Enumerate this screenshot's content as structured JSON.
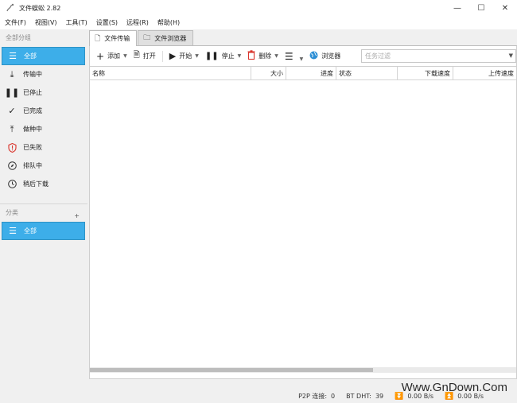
{
  "window": {
    "title": "文件蜈蚣 2.82"
  },
  "menu": [
    "文件(F)",
    "视图(V)",
    "工具(T)",
    "设置(S)",
    "远程(R)",
    "帮助(H)"
  ],
  "sidebar": {
    "group_header": "全部分组",
    "items": [
      {
        "label": "全部",
        "icon": "list-icon"
      },
      {
        "label": "传输中",
        "icon": "download-icon"
      },
      {
        "label": "已停止",
        "icon": "pause-icon"
      },
      {
        "label": "已完成",
        "icon": "check-icon"
      },
      {
        "label": "做种中",
        "icon": "upload-icon"
      },
      {
        "label": "已失败",
        "icon": "shield-alert-icon"
      },
      {
        "label": "排队中",
        "icon": "compass-icon"
      },
      {
        "label": "稍后下载",
        "icon": "clock-icon"
      }
    ],
    "category_header": "分类",
    "category_add": "+",
    "categories": [
      {
        "label": "全部",
        "icon": "list-icon"
      }
    ]
  },
  "tabs": [
    {
      "label": "文件传输",
      "icon": "file-icon"
    },
    {
      "label": "文件浏览器",
      "icon": "folder-icon"
    }
  ],
  "toolbar": {
    "add": "添加",
    "open": "打开",
    "start": "开始",
    "stop": "停止",
    "delete": "删除",
    "browser": "浏览器",
    "filter_placeholder": "任务过滤"
  },
  "table": {
    "columns": [
      "名称",
      "大小",
      "进度",
      "状态",
      "下载速度",
      "上传速度"
    ]
  },
  "status": {
    "p2p_label": "P2P 连接:",
    "p2p_value": "0",
    "dht_label": "BT DHT:",
    "dht_value": "39",
    "down_speed": "0.00 B/s",
    "up_speed": "0.00 B/s"
  },
  "watermark": "Www.GnDown.Com",
  "colors": {
    "accent": "#3daee9",
    "error": "#d9342b"
  }
}
